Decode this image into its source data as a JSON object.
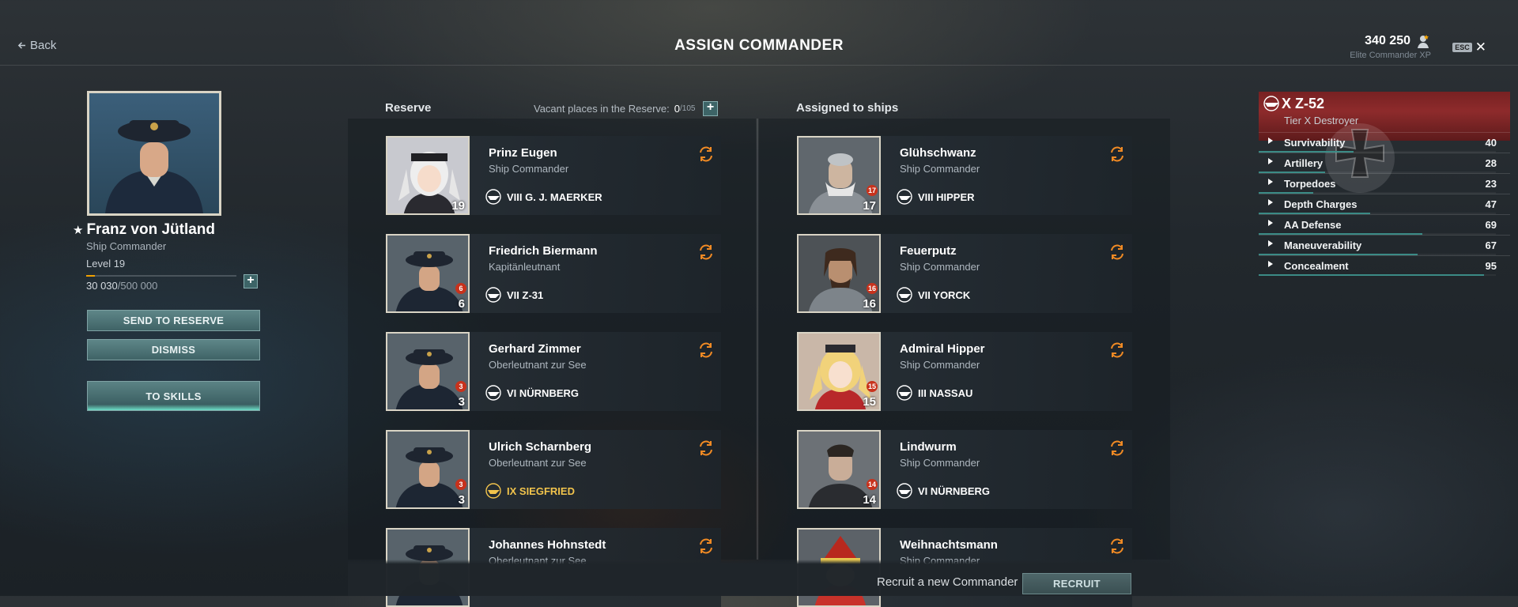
{
  "header": {
    "back_label": "Back",
    "title": "ASSIGN COMMANDER",
    "elite_xp_value": "340 250",
    "elite_xp_label": "Elite Commander XP",
    "esc_key": "ESC",
    "close_glyph": "✕"
  },
  "commander": {
    "name": "Franz von Jütland",
    "role": "Ship Commander",
    "level": "Level 19",
    "xp_current": "30 030",
    "xp_max": "/500 000",
    "level_progress": 0.06,
    "buttons": {
      "send_to_reserve": "SEND TO RESERVE",
      "dismiss": "DISMISS",
      "to_skills": "TO SKILLS"
    }
  },
  "reserve": {
    "title": "Reserve",
    "vacant_label": "Vacant places in the Reserve:",
    "vacant_count": "0",
    "vacant_total": "/105",
    "cards": [
      {
        "name": "Prinz Eugen",
        "rank": "Ship Commander",
        "ship": "VIII G. J. MAERKER",
        "level": "19",
        "points": "",
        "portrait": "anime-silver",
        "gold": false
      },
      {
        "name": "Friedrich Biermann",
        "rank": "Kapitänleutnant",
        "ship": "VII Z-31",
        "level": "6",
        "points": "6",
        "portrait": "officer",
        "gold": false
      },
      {
        "name": "Gerhard Zimmer",
        "rank": "Oberleutnant zur See",
        "ship": "VI NÜRNBERG",
        "level": "3",
        "points": "3",
        "portrait": "officer",
        "gold": false
      },
      {
        "name": "Ulrich Scharnberg",
        "rank": "Oberleutnant zur See",
        "ship": "IX SIEGFRIED",
        "level": "3",
        "points": "3",
        "portrait": "officer",
        "gold": true
      },
      {
        "name": "Johannes Hohnstedt",
        "rank": "Oberleutnant zur See",
        "ship": "",
        "level": "",
        "points": "",
        "portrait": "officer",
        "gold": false
      }
    ]
  },
  "assigned": {
    "title": "Assigned to ships",
    "cards": [
      {
        "name": "Glühschwanz",
        "rank": "Ship Commander",
        "ship": "VIII HIPPER",
        "level": "17",
        "points": "17",
        "portrait": "knight-grey",
        "gold": false
      },
      {
        "name": "Feuerputz",
        "rank": "Ship Commander",
        "ship": "VII YORCK",
        "level": "16",
        "points": "16",
        "portrait": "knight-brown",
        "gold": false
      },
      {
        "name": "Admiral Hipper",
        "rank": "Ship Commander",
        "ship": "III NASSAU",
        "level": "15",
        "points": "15",
        "portrait": "anime-blonde",
        "gold": false
      },
      {
        "name": "Lindwurm",
        "rank": "Ship Commander",
        "ship": "VI NÜRNBERG",
        "level": "14",
        "points": "14",
        "portrait": "knight-dark",
        "gold": false
      },
      {
        "name": "Weihnachtsmann",
        "rank": "Ship Commander",
        "ship": "",
        "level": "",
        "points": "",
        "portrait": "santa",
        "gold": false
      }
    ]
  },
  "ship_panel": {
    "name": "X Z-52",
    "tier": "Tier X Destroyer",
    "stats": [
      {
        "label": "Survivability",
        "value": "40"
      },
      {
        "label": "Artillery",
        "value": "28"
      },
      {
        "label": "Torpedoes",
        "value": "23"
      },
      {
        "label": "Depth Charges",
        "value": "47"
      },
      {
        "label": "AA Defense",
        "value": "69"
      },
      {
        "label": "Maneuverability",
        "value": "67"
      },
      {
        "label": "Concealment",
        "value": "95"
      }
    ]
  },
  "footer": {
    "recruit_text": "Recruit a new Commander",
    "recruit_button": "RECRUIT"
  },
  "colors": {
    "accent_teal": "#3f6366",
    "badge_red": "#c8321c",
    "premium_gold": "#f2c44c",
    "swap_orange": "#f08a24"
  }
}
